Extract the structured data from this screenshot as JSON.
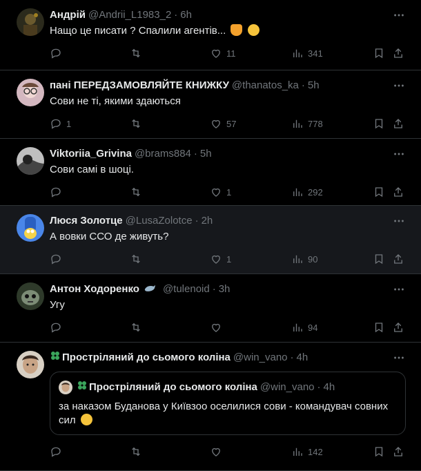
{
  "tweets": [
    {
      "name": "Андрій",
      "handle": "@Andrii_L1983_2",
      "time": "6h",
      "text": "Нащо це писати ? Спалили агентів...",
      "replies": "",
      "likes": "11",
      "views": "341",
      "avatar_color": "#4a3b1e"
    },
    {
      "name": "пані ПЕРЕДЗАМОВЛЯЙТЕ КНИЖКУ",
      "handle": "@thanatos_ka",
      "time": "5h",
      "text": "Сови не ті, якими здаються",
      "replies": "1",
      "likes": "57",
      "views": "778",
      "avatar_color": "#c9a9b4"
    },
    {
      "name": "Viktoriia_Grivina",
      "handle": "@brams884",
      "time": "5h",
      "text": "Сови самі в шоці.",
      "replies": "",
      "likes": "1",
      "views": "292",
      "avatar_color": "#8a8a8a"
    },
    {
      "name": "Люся Золотце",
      "handle": "@LusaZolotce",
      "time": "2h",
      "text": "А вовки ССО де живуть?",
      "replies": "",
      "likes": "1",
      "views": "90",
      "avatar_color": "#3b6fd4"
    },
    {
      "name": "Антон Ходоренко",
      "handle": "@tulenoid",
      "time": "3h",
      "text": "Угу",
      "replies": "",
      "likes": "",
      "views": "94",
      "avatar_color": "#4a5a44"
    },
    {
      "name": "Простріляний до сьомого коліна",
      "handle": "@win_vano",
      "time": "4h",
      "text": "",
      "replies": "",
      "likes": "",
      "views": "142",
      "avatar_color": "#b89a80",
      "quote": {
        "name": "Простріляний до сьомого коліна",
        "handle": "@win_vano",
        "time": "4h",
        "text": "за наказом Буданова у Київзоо оселилися сови - командувач совних сил"
      }
    }
  ],
  "accent_colors": {
    "background": "#000000",
    "highlight": "#16181c",
    "text": "#e7e9ea",
    "muted": "#71767b",
    "border": "#2f3336"
  }
}
